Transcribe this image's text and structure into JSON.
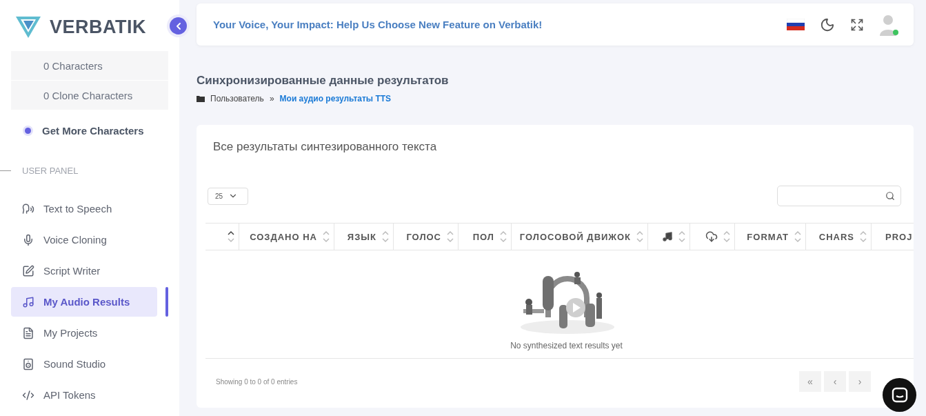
{
  "brand": {
    "name": "VERBATIK"
  },
  "sidebar": {
    "credits": [
      {
        "label": "0 Characters"
      },
      {
        "label": "0 Clone Characters"
      }
    ],
    "get_more": "Get More Characters",
    "section": "USER PANEL",
    "items": [
      {
        "label": "Text to Speech",
        "selected": false
      },
      {
        "label": "Voice Cloning",
        "selected": false
      },
      {
        "label": "Script Writer",
        "selected": false
      },
      {
        "label": "My Audio Results",
        "selected": true
      },
      {
        "label": "My Projects",
        "selected": false
      },
      {
        "label": "Sound Studio",
        "selected": false
      },
      {
        "label": "API Tokens",
        "selected": false
      }
    ]
  },
  "header": {
    "announcement": "Your Voice, Your Impact: Help Us Choose New Feature on Verbatik!",
    "user_online": true
  },
  "page": {
    "title": "Синхронизированные данные результатов",
    "breadcrumb": [
      {
        "label": "Пользователь",
        "kind": "plain"
      },
      {
        "label": "»",
        "kind": "separator"
      },
      {
        "label": "Мои аудио результаты TTS",
        "kind": "link"
      }
    ]
  },
  "table_card": {
    "title": "Все результаты синтезированного текста",
    "page_size": "25",
    "columns": [
      {
        "kind": "blank",
        "sorted": true
      },
      {
        "kind": "text",
        "label": "СОЗДАНО НА",
        "sorted": false
      },
      {
        "kind": "text",
        "label": "ЯЗЫК",
        "sorted": false
      },
      {
        "kind": "text",
        "label": "ГОЛОС",
        "sorted": false
      },
      {
        "kind": "text",
        "label": "ПОЛ",
        "sorted": false
      },
      {
        "kind": "text",
        "label": "ГОЛОСОВОЙ ДВИЖОК",
        "sorted": false
      },
      {
        "kind": "music",
        "sorted": false
      },
      {
        "kind": "download",
        "sorted": false
      },
      {
        "kind": "text",
        "label": "FORMAT",
        "sorted": false
      },
      {
        "kind": "text",
        "label": "CHARS",
        "sorted": false
      },
      {
        "kind": "text",
        "label": "PROJ"
      }
    ],
    "empty_message": "No synthesized text results yet",
    "info": "Showing 0 to 0 of 0 entries",
    "pagination": [
      {
        "label": "«",
        "disabled": true
      },
      {
        "label": "‹",
        "disabled": true
      },
      {
        "label": "›",
        "disabled": true
      }
    ]
  }
}
